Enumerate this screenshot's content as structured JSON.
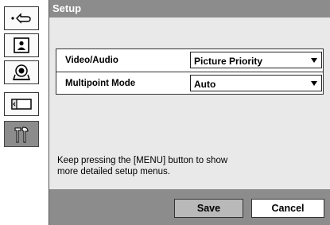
{
  "sidebar": {
    "items": [
      {
        "icon": "return-icon"
      },
      {
        "icon": "person-portrait-icon"
      },
      {
        "icon": "camera-icon"
      },
      {
        "icon": "screen-icon"
      },
      {
        "icon": "tools-icon",
        "active": true
      }
    ]
  },
  "panel": {
    "title": "Setup",
    "settings": [
      {
        "label": "Video/Audio",
        "value": "Picture Priority"
      },
      {
        "label": "Multipoint Mode",
        "value": "Auto"
      }
    ],
    "help_line1": "Keep pressing the [MENU] button to show",
    "help_line2": "more detailed setup menus.",
    "buttons": {
      "save": "Save",
      "cancel": "Cancel"
    }
  },
  "colors": {
    "title_bar": "#8c8c8c",
    "panel_bg": "#e9e9e9",
    "active_sidebar": "#8c8c8c"
  }
}
